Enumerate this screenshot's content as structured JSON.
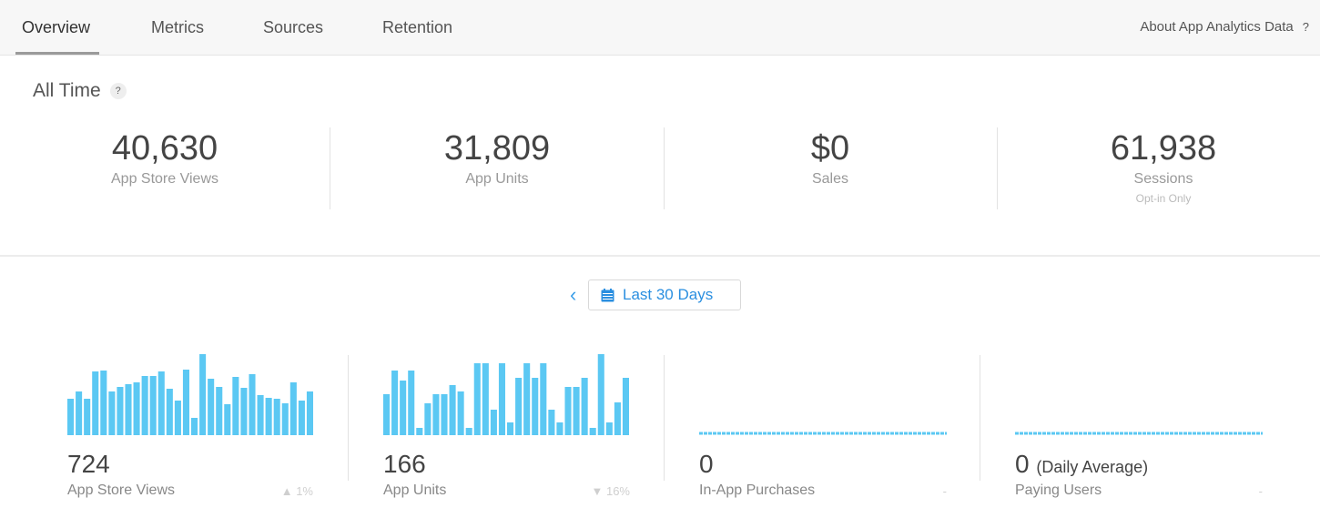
{
  "tabs": {
    "overview": "Overview",
    "metrics": "Metrics",
    "sources": "Sources",
    "retention": "Retention",
    "about": "About App Analytics Data",
    "about_help": "?"
  },
  "all_time": {
    "title": "All Time",
    "help": "?",
    "stats": [
      {
        "value": "40,630",
        "label": "App Store Views",
        "sub": ""
      },
      {
        "value": "31,809",
        "label": "App Units",
        "sub": ""
      },
      {
        "value": "$0",
        "label": "Sales",
        "sub": ""
      },
      {
        "value": "61,938",
        "label": "Sessions",
        "sub": "Opt-in Only"
      }
    ]
  },
  "date_range": {
    "prev_arrow": "‹",
    "label": "Last 30 Days",
    "icon": "calendar-icon"
  },
  "colors": {
    "accent": "#2b8fe0",
    "bar": "#5bc8f3",
    "divider": "#e2e2e2"
  },
  "metrics": [
    {
      "value": "724",
      "suffix": "",
      "label": "App Store Views",
      "change_arrow": "▲",
      "change": "1%"
    },
    {
      "value": "166",
      "suffix": "",
      "label": "App Units",
      "change_arrow": "▼",
      "change": "16%"
    },
    {
      "value": "0",
      "suffix": "",
      "label": "In-App Purchases",
      "change_arrow": "",
      "change": "-"
    },
    {
      "value": "0",
      "suffix": "(Daily Average)",
      "label": "Paying Users",
      "change_arrow": "",
      "change": "-"
    }
  ],
  "chart_data": [
    {
      "type": "bar",
      "series": [
        {
          "values": [
            40,
            48,
            40,
            70,
            71,
            48,
            53,
            56,
            58,
            65,
            65,
            70,
            51,
            38,
            72,
            19,
            89,
            62,
            53,
            34,
            64,
            52,
            67,
            44,
            41,
            40,
            35,
            58,
            38,
            48
          ]
        }
      ],
      "ylim": [
        0,
        90
      ]
    },
    {
      "type": "bar",
      "series": [
        {
          "values": [
            45,
            71,
            60,
            71,
            8,
            35,
            45,
            45,
            55,
            48,
            8,
            79,
            79,
            28,
            79,
            14,
            63,
            79,
            63,
            79,
            28,
            14,
            53,
            53,
            63,
            8,
            89,
            14,
            36,
            63
          ]
        }
      ],
      "ylim": [
        0,
        90
      ]
    },
    {
      "type": "line",
      "series": [
        {
          "values": [
            0,
            0,
            0,
            0,
            0,
            0,
            0,
            0,
            0,
            0,
            0,
            0,
            0,
            0,
            0,
            0,
            0,
            0,
            0,
            0,
            0,
            0,
            0,
            0,
            0,
            0,
            0,
            0,
            0,
            0
          ]
        }
      ]
    },
    {
      "type": "line",
      "series": [
        {
          "values": [
            0,
            0,
            0,
            0,
            0,
            0,
            0,
            0,
            0,
            0,
            0,
            0,
            0,
            0,
            0,
            0,
            0,
            0,
            0,
            0,
            0,
            0,
            0,
            0,
            0,
            0,
            0,
            0,
            0,
            0
          ]
        }
      ]
    }
  ]
}
